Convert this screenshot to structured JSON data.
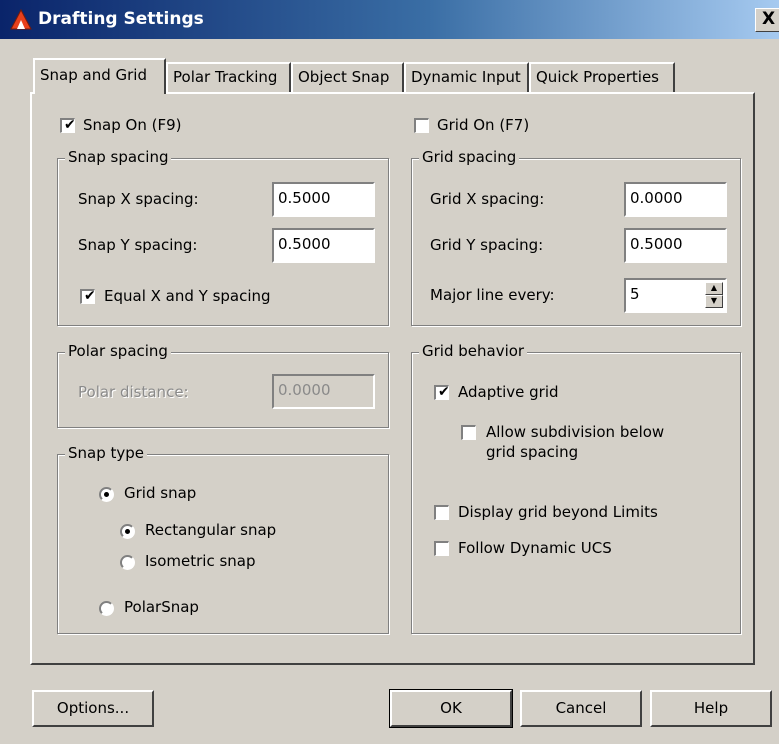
{
  "window": {
    "title": "Drafting Settings",
    "close_label": "X"
  },
  "tabs": [
    "Snap and Grid",
    "Polar Tracking",
    "Object Snap",
    "Dynamic Input",
    "Quick Properties"
  ],
  "snap": {
    "snap_on_label": "Snap On (F9)",
    "snap_on_checked": true,
    "spacing_title": "Snap spacing",
    "x_label": "Snap X spacing:",
    "x_value": "0.5000",
    "y_label": "Snap Y spacing:",
    "y_value": "0.5000",
    "equal_label": "Equal X and Y spacing",
    "equal_checked": true
  },
  "polar": {
    "title": "Polar spacing",
    "distance_label": "Polar distance:",
    "distance_value": "0.0000"
  },
  "snap_type": {
    "title": "Snap type",
    "grid_snap": "Grid snap",
    "rect_snap": "Rectangular snap",
    "iso_snap": "Isometric snap",
    "polar_snap": "PolarSnap"
  },
  "grid": {
    "grid_on_label": "Grid On (F7)",
    "grid_on_checked": false,
    "spacing_title": "Grid spacing",
    "x_label": "Grid X spacing:",
    "x_value": "0.0000",
    "y_label": "Grid Y spacing:",
    "y_value": "0.5000",
    "major_label": "Major line every:",
    "major_value": "5"
  },
  "grid_behavior": {
    "title": "Grid behavior",
    "adaptive": "Adaptive grid",
    "subdivision_line1": "Allow subdivision below",
    "subdivision_line2": "grid spacing",
    "beyond_limits": "Display grid beyond Limits",
    "follow_ucs": "Follow Dynamic UCS"
  },
  "buttons": {
    "options": "Options...",
    "ok": "OK",
    "cancel": "Cancel",
    "help": "Help"
  },
  "colors": {
    "dialog_bg": "#d4d0c8",
    "titlebar_start": "#0a246a",
    "titlebar_end": "#a6caf0"
  }
}
